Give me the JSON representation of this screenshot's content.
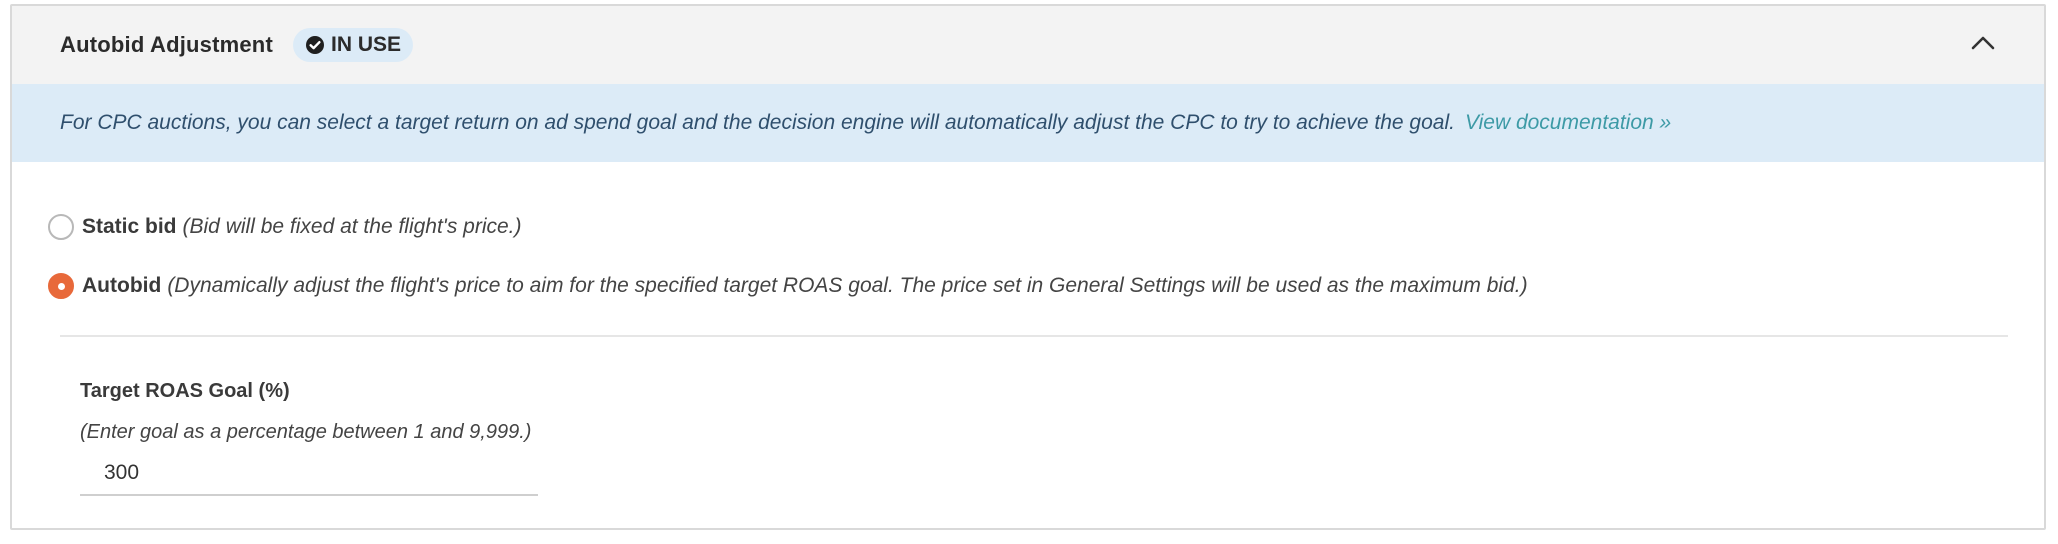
{
  "header": {
    "title": "Autobid Adjustment",
    "status_badge": "IN USE",
    "status_icon": "check-circle-icon",
    "collapse_icon": "chevron-up-icon"
  },
  "info": {
    "text": "For CPC auctions, you can select a target return on ad spend goal and the decision engine will automatically adjust the CPC to try to achieve the goal.",
    "link_text": "View documentation »"
  },
  "options": {
    "static": {
      "label": "Static bid",
      "description": "(Bid will be fixed at the flight's price.)",
      "selected": false
    },
    "autobid": {
      "label": "Autobid",
      "description": "(Dynamically adjust the flight's price to aim for the specified target ROAS goal. The price set in General Settings will be used as the maximum bid.)",
      "selected": true
    }
  },
  "target_field": {
    "label": "Target ROAS Goal (%)",
    "hint": "(Enter goal as a percentage between 1 and 9,999.)",
    "value": "300"
  },
  "colors": {
    "accent_radio": "#e8693a",
    "info_background": "#dcebf7",
    "link": "#3d9aa6",
    "header_background": "#f3f3f3"
  }
}
